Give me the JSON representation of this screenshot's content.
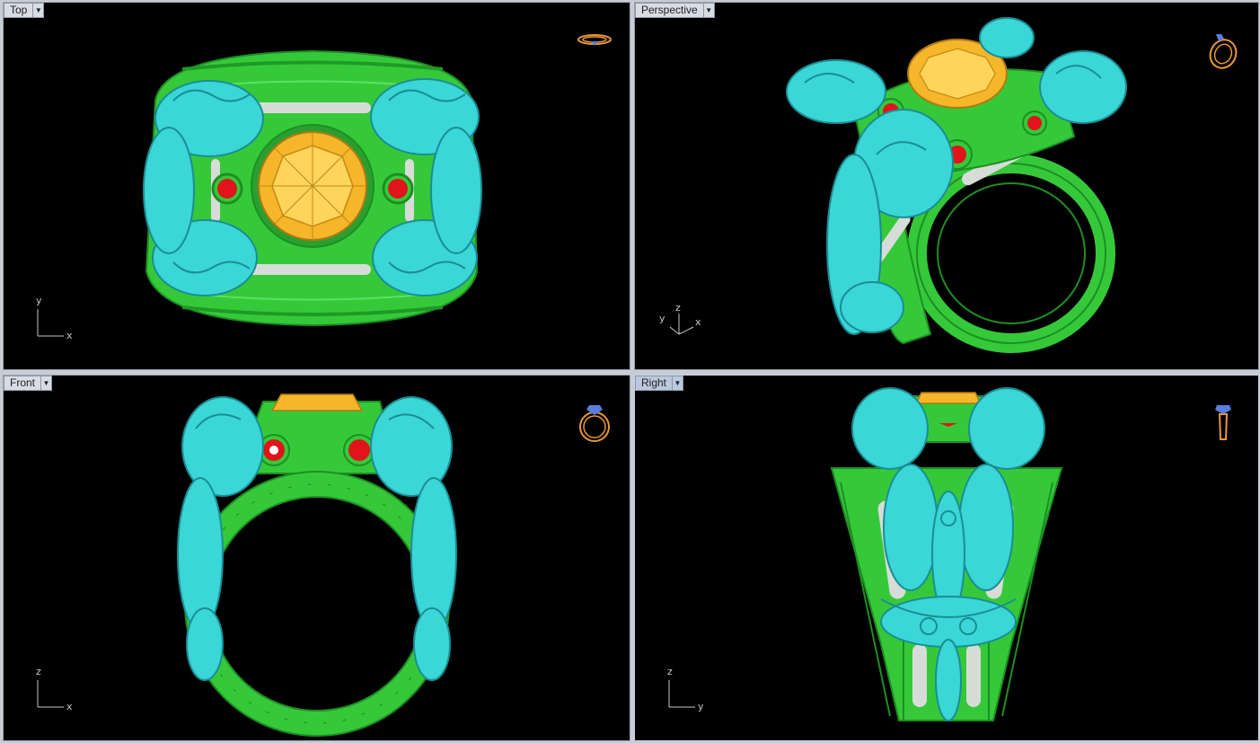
{
  "viewports": {
    "top": {
      "title": "Top",
      "axis_a": "y",
      "axis_b": "x"
    },
    "perspective": {
      "title": "Perspective",
      "axis_a": "z",
      "axis_b": "y",
      "axis_c": "x"
    },
    "front": {
      "title": "Front",
      "axis_a": "z",
      "axis_b": "x"
    },
    "right": {
      "title": "Right",
      "axis_a": "z",
      "axis_b": "y"
    }
  },
  "active_viewport": "right",
  "icons": {
    "viewport_menu": "chevron-down-icon",
    "nav_widget": "ring-orientation-icon"
  },
  "colors": {
    "viewport_bg": "#000000",
    "band": "#35c93a",
    "dragons": "#3ad6d8",
    "center_gem": "#f5b62a",
    "side_gems": "#e0141a",
    "inlay": "#d8dcd8",
    "nav_icon": "#e8973a"
  }
}
